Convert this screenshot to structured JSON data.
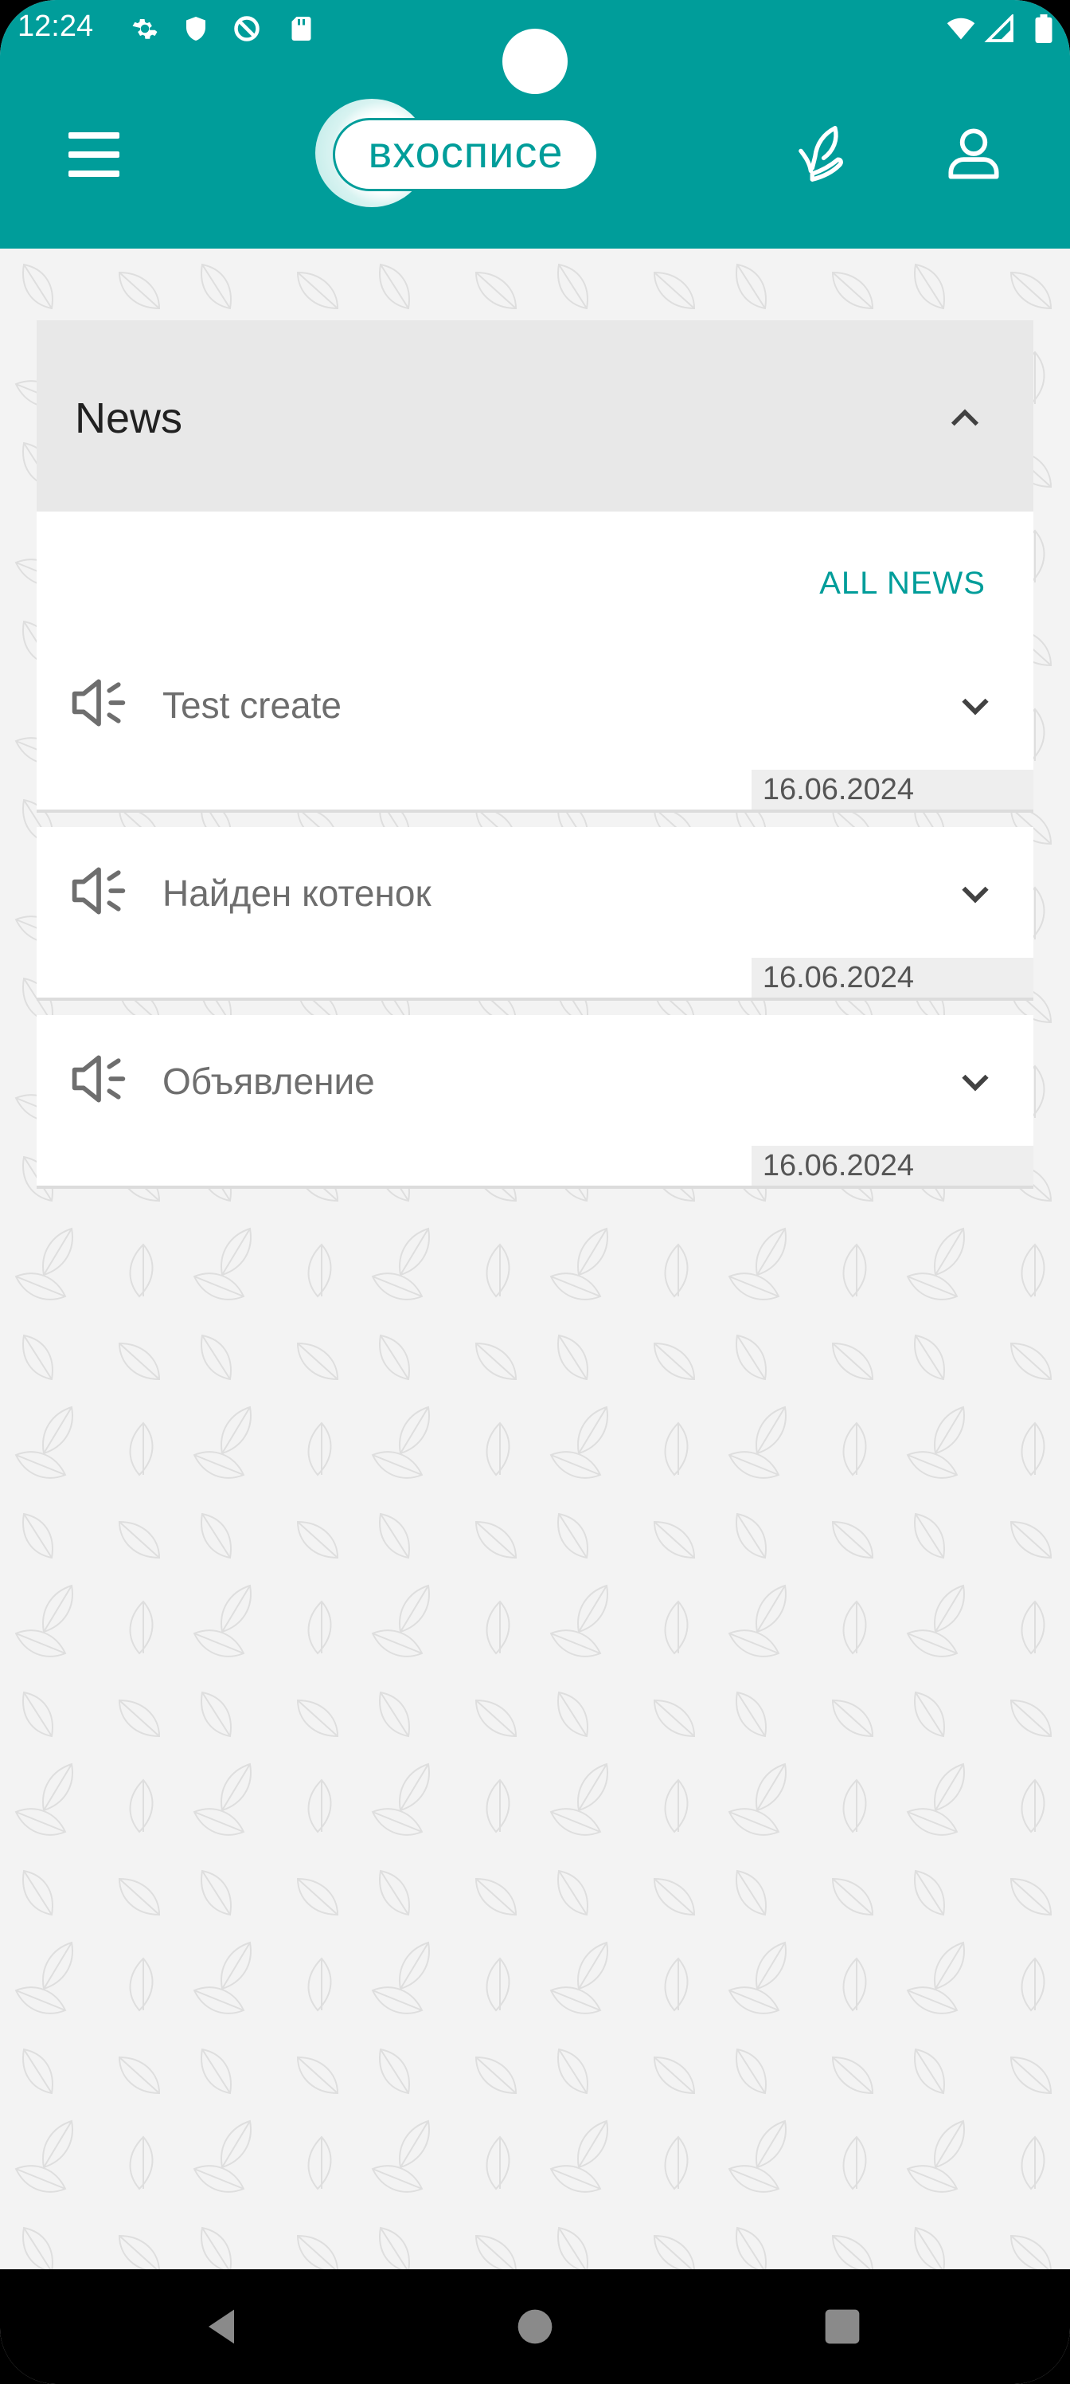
{
  "status_bar": {
    "time": "12:24",
    "left_icons": [
      "gear-icon",
      "shield-icon",
      "do-not-disturb-icon",
      "sd-card-icon"
    ],
    "right_icons": [
      "wifi-icon",
      "signal-icon",
      "battery-icon"
    ]
  },
  "app_bar": {
    "logo_text": "вхосписе",
    "menu_icon": "menu-icon",
    "leaf_icon": "leaf-hand-icon",
    "profile_icon": "user-icon"
  },
  "news": {
    "title": "News",
    "all_news_label": "ALL NEWS",
    "items": [
      {
        "title": "Test create",
        "date": "16.06.2024"
      },
      {
        "title": "Найден котенок",
        "date": "16.06.2024"
      },
      {
        "title": "Объявление",
        "date": "16.06.2024"
      }
    ]
  },
  "colors": {
    "accent": "#009d9a",
    "background": "#f3f3f3",
    "header_bg": "#e8e8e8"
  }
}
